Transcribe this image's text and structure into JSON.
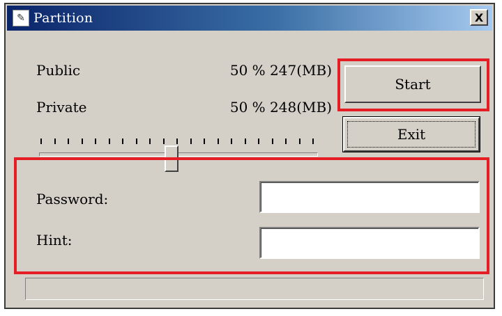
{
  "window": {
    "title": "Partition",
    "close_label": "X"
  },
  "partition": {
    "public_label": "Public",
    "public_value": "50 % 247(MB)",
    "private_label": "Private",
    "private_value": "50 % 248(MB)",
    "slider_level_percent": 50
  },
  "buttons": {
    "start_label": "Start",
    "exit_label": "Exit"
  },
  "fields": {
    "password_label": "Password:",
    "password_value": "",
    "hint_label": "Hint:",
    "hint_value": ""
  },
  "status_bar": {
    "text": ""
  },
  "colors": {
    "highlight": "#e41e24",
    "window_face": "#d4d0c8",
    "titlebar_start": "#0a246a",
    "titlebar_end": "#a6caf0"
  }
}
